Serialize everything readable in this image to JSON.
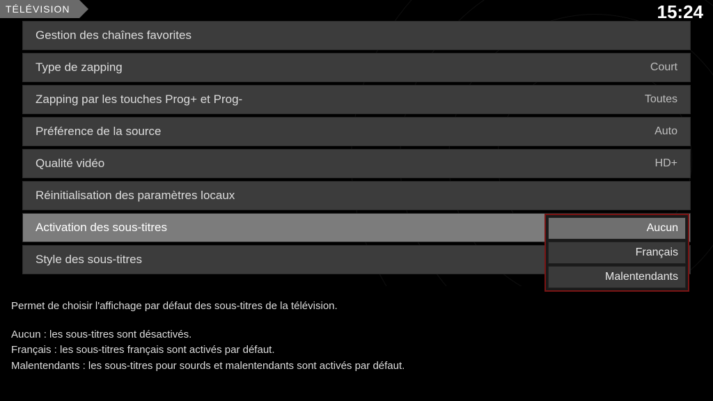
{
  "header": {
    "breadcrumb": "TÉLÉVISION",
    "clock": "15:24"
  },
  "menu": {
    "items": [
      {
        "label": "Gestion des chaînes favorites",
        "value": ""
      },
      {
        "label": "Type de zapping",
        "value": "Court"
      },
      {
        "label": "Zapping par les touches Prog+ et Prog-",
        "value": "Toutes"
      },
      {
        "label": "Préférence de la source",
        "value": "Auto"
      },
      {
        "label": "Qualité vidéo",
        "value": "HD+"
      },
      {
        "label": "Réinitialisation des paramètres locaux",
        "value": ""
      },
      {
        "label": "Activation des sous-titres",
        "value": ""
      },
      {
        "label": "Style des sous-titres",
        "value": ""
      }
    ],
    "selected_index": 6
  },
  "dropdown": {
    "options": [
      "Aucun",
      "Français",
      "Malentendants"
    ],
    "selected_index": 0
  },
  "help": {
    "intro": "Permet de choisir l'affichage par défaut des sous-titres de la télévision.",
    "lines": [
      "Aucun : les sous-titres sont désactivés.",
      "Français : les sous-titres français sont activés par défaut.",
      "Malentendants : les sous-titres pour sourds et malentendants sont activés par défaut."
    ]
  }
}
